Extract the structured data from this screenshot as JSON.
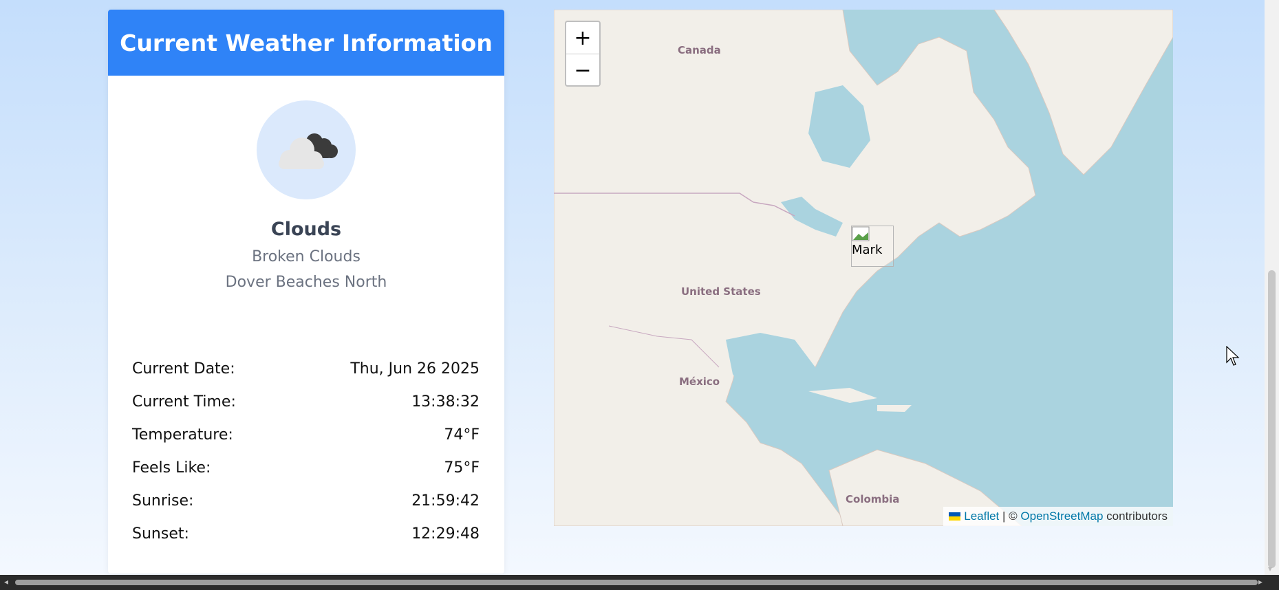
{
  "weather": {
    "header_title": "Current Weather Information",
    "icon": "broken-clouds-icon",
    "condition_main": "Clouds",
    "condition_description": "Broken Clouds",
    "location": "Dover Beaches North",
    "rows": [
      {
        "label": "Current Date:",
        "value": "Thu, Jun 26 2025"
      },
      {
        "label": "Current Time:",
        "value": "13:38:32"
      },
      {
        "label": "Temperature:",
        "value": "74°F"
      },
      {
        "label": "Feels Like:",
        "value": "75°F"
      },
      {
        "label": "Sunrise:",
        "value": "21:59:42"
      },
      {
        "label": "Sunset:",
        "value": "12:29:48"
      }
    ],
    "header_color": "#2f83f7"
  },
  "map": {
    "zoom_in_label": "+",
    "zoom_out_label": "−",
    "labels": {
      "canada": "Canada",
      "united_states": "United States",
      "mexico": "México",
      "colombia": "Colombia"
    },
    "marker_alt": "Mark",
    "attribution": {
      "leaflet": "Leaflet",
      "separator": "| ©",
      "osm": "OpenStreetMap",
      "contributors": "contributors"
    }
  }
}
